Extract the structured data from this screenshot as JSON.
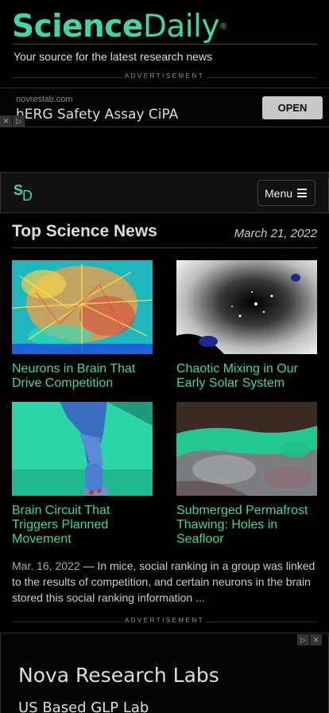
{
  "header": {
    "logo_part1": "Science",
    "logo_part2": "Daily",
    "logo_mark": "®",
    "tagline": "Your source for the latest research news"
  },
  "ad_label": "ADVERTISEMENT",
  "top_ad": {
    "domain": "novreslab.com",
    "title": "hERG Safety Assay CiPA",
    "cta": "OPEN",
    "icons": [
      "close-icon",
      "adchoices-icon"
    ]
  },
  "nav": {
    "logo_s": "S",
    "logo_d": "D",
    "menu_label": "Menu",
    "menu_icon": "hamburger-icon"
  },
  "section": {
    "title": "Top Science News",
    "date": "March 21, 2022"
  },
  "stories": [
    {
      "headline": "Neurons in Brain That Drive Competition",
      "image": "neurons-image"
    },
    {
      "headline": "Chaotic Mixing in Our Early Solar System",
      "image": "solar-system-image"
    },
    {
      "headline": "Brain Circuit That Triggers Planned Movement",
      "image": "runner-image"
    },
    {
      "headline": "Submerged Permafrost Thawing: Holes in Seafloor",
      "image": "seafloor-image"
    }
  ],
  "summary": {
    "date": "Mar. 16, 2022",
    "dash": " — ",
    "text": "In mice, social ranking in a group was linked to the results of competition, and certain neurons in the brain stored this social ranking information ..."
  },
  "bottom_ad": {
    "title": "Nova Research Labs",
    "subtitle": "US Based GLP Lab"
  },
  "colors": {
    "accent": "#3ed6a8",
    "background": "#000000",
    "text": "#dddddd"
  }
}
